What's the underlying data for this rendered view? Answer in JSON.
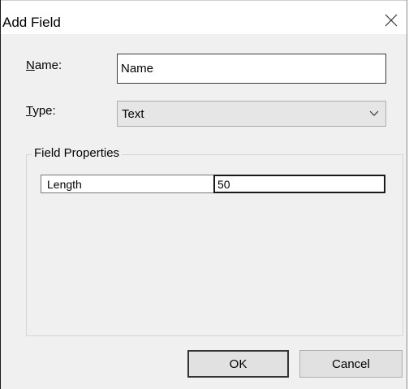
{
  "dialog": {
    "title": "Add Field",
    "close_icon": "close-icon"
  },
  "name_field": {
    "label_mnemonic": "N",
    "label_rest": "ame:",
    "value": "Name"
  },
  "type_field": {
    "label_mnemonic": "T",
    "label_rest": "ype:",
    "selected": "Text",
    "dropdown_icon": "chevron-down-icon"
  },
  "field_properties": {
    "legend": "Field Properties",
    "rows": [
      {
        "name": "Length",
        "value": "50"
      }
    ]
  },
  "buttons": {
    "ok": "OK",
    "cancel": "Cancel"
  }
}
